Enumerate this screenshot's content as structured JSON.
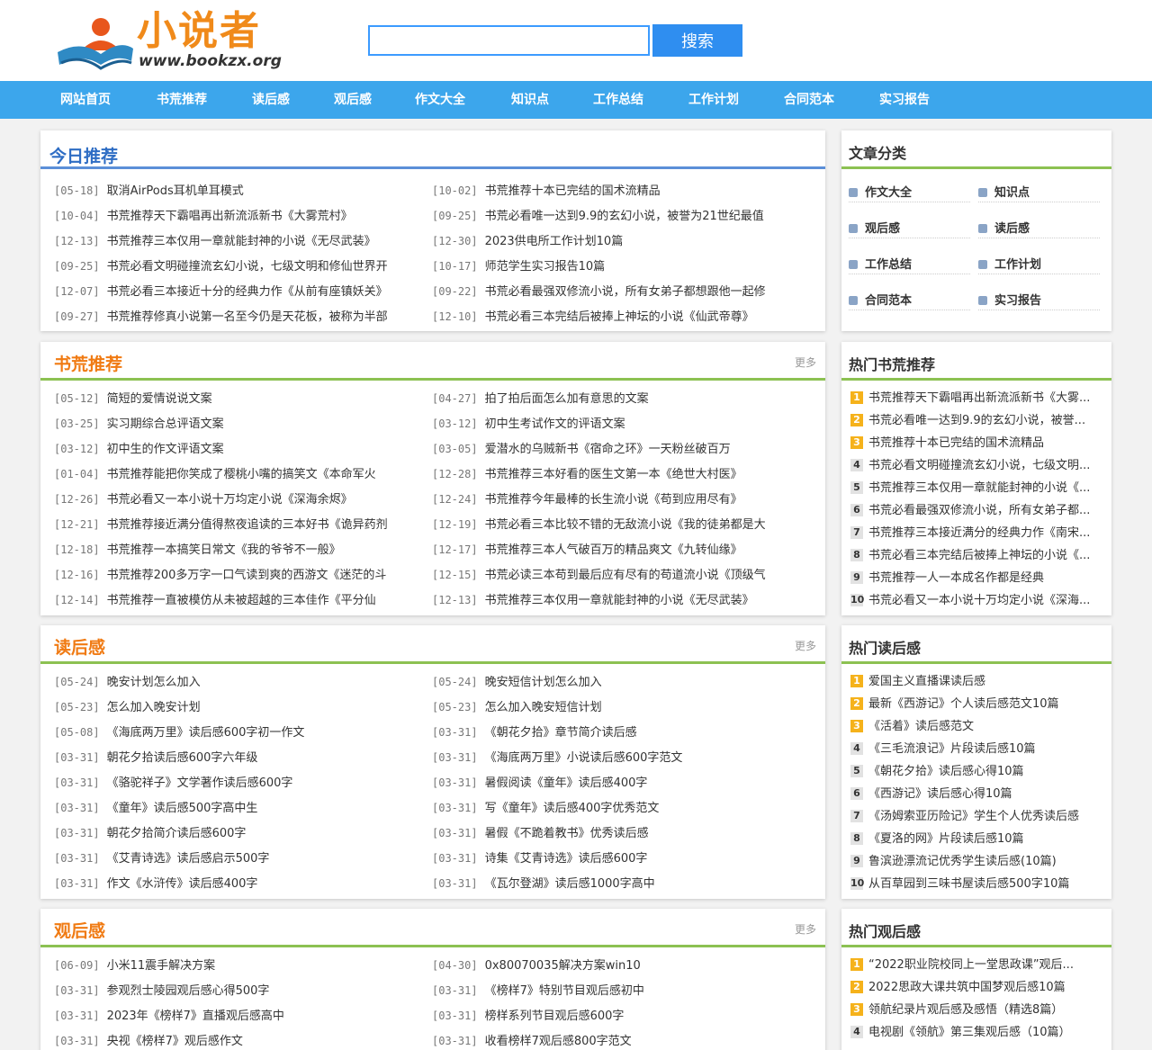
{
  "site": {
    "logo_title": "小说者",
    "logo_url": "www.bookzx.org",
    "search_button": "搜索",
    "search_value": ""
  },
  "nav": [
    "网站首页",
    "书荒推荐",
    "读后感",
    "观后感",
    "作文大全",
    "知识点",
    "工作总结",
    "工作计划",
    "合同范本",
    "实习报告"
  ],
  "today": {
    "title": "今日推荐",
    "left": [
      {
        "date": "[05-18]",
        "title": "取消AirPods耳机单耳模式"
      },
      {
        "date": "[10-04]",
        "title": "书荒推荐天下霸唱再出新流派新书《大雾荒村》"
      },
      {
        "date": "[12-13]",
        "title": "书荒推荐三本仅用一章就能封神的小说《无尽武装》"
      },
      {
        "date": "[09-25]",
        "title": "书荒必看文明碰撞流玄幻小说，七级文明和修仙世界开"
      },
      {
        "date": "[12-07]",
        "title": "书荒必看三本接近十分的经典力作《从前有座镇妖关》"
      },
      {
        "date": "[09-27]",
        "title": "书荒推荐修真小说第一名至今仍是天花板，被称为半部"
      }
    ],
    "right": [
      {
        "date": "[10-02]",
        "title": "书荒推荐十本已完结的国术流精品"
      },
      {
        "date": "[09-25]",
        "title": "书荒必看唯一达到9.9的玄幻小说，被誉为21世纪最值"
      },
      {
        "date": "[12-30]",
        "title": "2023供电所工作计划10篇"
      },
      {
        "date": "[10-17]",
        "title": "师范学生实习报告10篇"
      },
      {
        "date": "[09-22]",
        "title": "书荒必看最强双修流小说，所有女弟子都想跟他一起修"
      },
      {
        "date": "[12-10]",
        "title": "书荒必看三本完结后被捧上神坛的小说《仙武帝尊》"
      }
    ]
  },
  "more_label": "更多",
  "shuhuang": {
    "title": "书荒推荐",
    "left": [
      {
        "date": "[05-12]",
        "title": "简短的爱情说说文案"
      },
      {
        "date": "[03-25]",
        "title": "实习期综合总评语文案"
      },
      {
        "date": "[03-12]",
        "title": "初中生的作文评语文案"
      },
      {
        "date": "[01-04]",
        "title": "书荒推荐能把你笑成了樱桃小嘴的搞笑文《本命军火"
      },
      {
        "date": "[12-26]",
        "title": "书荒必看又一本小说十万均定小说《深海余烬》"
      },
      {
        "date": "[12-21]",
        "title": "书荒推荐接近满分值得熬夜追读的三本好书《诡异药剂"
      },
      {
        "date": "[12-18]",
        "title": "书荒推荐一本搞笑日常文《我的爷爷不一般》"
      },
      {
        "date": "[12-16]",
        "title": "书荒推荐200多万字一口气读到爽的西游文《迷茫的斗"
      },
      {
        "date": "[12-14]",
        "title": "书荒推荐一直被模仿从未被超越的三本佳作《平分仙"
      }
    ],
    "right": [
      {
        "date": "[04-27]",
        "title": "拍了拍后面怎么加有意思的文案"
      },
      {
        "date": "[03-12]",
        "title": "初中生考试作文的评语文案"
      },
      {
        "date": "[03-05]",
        "title": "爱潜水的乌贼新书《宿命之环》一天粉丝破百万"
      },
      {
        "date": "[12-28]",
        "title": "书荒推荐三本好看的医生文第一本《绝世大村医》"
      },
      {
        "date": "[12-24]",
        "title": "书荒推荐今年最棒的长生流小说《苟到应用尽有》"
      },
      {
        "date": "[12-19]",
        "title": "书荒必看三本比较不错的无敌流小说《我的徒弟都是大"
      },
      {
        "date": "[12-17]",
        "title": "书荒推荐三本人气破百万的精品爽文《九转仙缘》"
      },
      {
        "date": "[12-15]",
        "title": "书荒必读三本苟到最后应有尽有的苟道流小说《顶级气"
      },
      {
        "date": "[12-13]",
        "title": "书荒推荐三本仅用一章就能封神的小说《无尽武装》"
      }
    ]
  },
  "duhougan": {
    "title": "读后感",
    "left": [
      {
        "date": "[05-24]",
        "title": "晚安计划怎么加入"
      },
      {
        "date": "[05-23]",
        "title": "怎么加入晚安计划"
      },
      {
        "date": "[05-08]",
        "title": "《海底两万里》读后感600字初一作文"
      },
      {
        "date": "[03-31]",
        "title": "朝花夕拾读后感600字六年级"
      },
      {
        "date": "[03-31]",
        "title": "《骆驼祥子》文学著作读后感600字"
      },
      {
        "date": "[03-31]",
        "title": "《童年》读后感500字高中生"
      },
      {
        "date": "[03-31]",
        "title": "朝花夕拾简介读后感600字"
      },
      {
        "date": "[03-31]",
        "title": "《艾青诗选》读后感启示500字"
      },
      {
        "date": "[03-31]",
        "title": "作文《水浒传》读后感400字"
      }
    ],
    "right": [
      {
        "date": "[05-24]",
        "title": "晚安短信计划怎么加入"
      },
      {
        "date": "[05-23]",
        "title": "怎么加入晚安短信计划"
      },
      {
        "date": "[03-31]",
        "title": "《朝花夕拾》章节简介读后感"
      },
      {
        "date": "[03-31]",
        "title": "《海底两万里》小说读后感600字范文"
      },
      {
        "date": "[03-31]",
        "title": "暑假阅读《童年》读后感400字"
      },
      {
        "date": "[03-31]",
        "title": "写《童年》读后感400字优秀范文"
      },
      {
        "date": "[03-31]",
        "title": "暑假《不跪着教书》优秀读后感"
      },
      {
        "date": "[03-31]",
        "title": "诗集《艾青诗选》读后感600字"
      },
      {
        "date": "[03-31]",
        "title": "《瓦尔登湖》读后感1000字高中"
      }
    ]
  },
  "guanhougan": {
    "title": "观后感",
    "left": [
      {
        "date": "[06-09]",
        "title": "小米11震手解决方案"
      },
      {
        "date": "[03-31]",
        "title": "参观烈士陵园观后感心得500字"
      },
      {
        "date": "[03-31]",
        "title": "2023年《榜样7》直播观后感高中"
      },
      {
        "date": "[03-31]",
        "title": "央视《榜样7》观后感作文"
      }
    ],
    "right": [
      {
        "date": "[04-30]",
        "title": "0x80070035解决方案win10"
      },
      {
        "date": "[03-31]",
        "title": "《榜样7》特别节目观后感初中"
      },
      {
        "date": "[03-31]",
        "title": "榜样系列节目观后感600字"
      },
      {
        "date": "[03-31]",
        "title": "收看榜样7观后感800字范文"
      }
    ]
  },
  "categories": {
    "title": "文章分类",
    "items": [
      "作文大全",
      "知识点",
      "观后感",
      "读后感",
      "工作总结",
      "工作计划",
      "合同范本",
      "实习报告"
    ]
  },
  "hot_shuhuang": {
    "title": "热门书荒推荐",
    "items": [
      "书荒推荐天下霸唱再出新流派新书《大雾...",
      "书荒必看唯一达到9.9的玄幻小说，被誉...",
      "书荒推荐十本已完结的国术流精品",
      "书荒必看文明碰撞流玄幻小说，七级文明...",
      "书荒推荐三本仅用一章就能封神的小说《...",
      "书荒必看最强双修流小说，所有女弟子都...",
      "书荒推荐三本接近满分的经典力作《南宋...",
      "书荒必看三本完结后被捧上神坛的小说《...",
      "书荒推荐一人一本成名作都是经典",
      "书荒必看又一本小说十万均定小说《深海..."
    ]
  },
  "hot_duhougan": {
    "title": "热门读后感",
    "items": [
      "爱国主义直播课读后感",
      "最新《西游记》个人读后感范文10篇",
      "《活着》读后感范文",
      "《三毛流浪记》片段读后感10篇",
      "《朝花夕拾》读后感心得10篇",
      "《西游记》读后感心得10篇",
      "《汤姆索亚历险记》学生个人优秀读后感",
      "《夏洛的网》片段读后感10篇",
      "鲁滨逊漂流记优秀学生读后感(10篇)",
      "从百草园到三味书屋读后感500字10篇"
    ]
  },
  "hot_guanhougan": {
    "title": "热门观后感",
    "items": [
      "“2022职业院校同上一堂思政课”观后...",
      "2022思政大课共筑中国梦观后感10篇",
      "领航纪录片观后感及感悟（精选8篇）",
      "电视剧《领航》第三集观后感（10篇）"
    ]
  },
  "colors": {
    "nav": "#3ca6ec",
    "accent_orange": "#f07a12",
    "accent_blue": "#2e6dc4",
    "green_line": "#8cc152",
    "rank_top": "#f5b21b"
  }
}
